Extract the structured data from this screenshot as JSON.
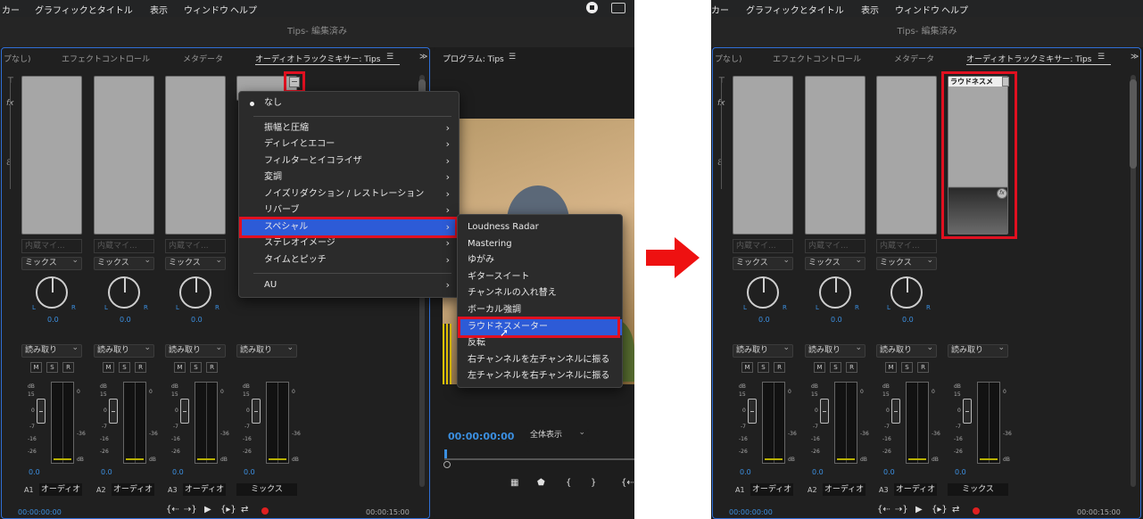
{
  "menubar": {
    "items": [
      "カー",
      "グラフィックとタイトル",
      "表示",
      "ウィンドウ",
      "ヘルプ"
    ]
  },
  "window_title": "Tips- 編集済み",
  "tabs": {
    "t1": "プなし)",
    "t2": "エフェクトコントロール",
    "t3": "メタデータ",
    "t4": "オーディオトラックミキサー: Tips",
    "more": "≫",
    "program": "プログラム: Tips"
  },
  "channels": [
    {
      "input": "内蔵マイ...",
      "mix": "ミックス",
      "pan": "0.0",
      "auto": "読み取り",
      "level": "0.0",
      "track_id": "A1",
      "track_name": "オーディオ"
    },
    {
      "input": "内蔵マイ...",
      "mix": "ミックス",
      "pan": "0.0",
      "auto": "読み取り",
      "level": "0.0",
      "track_id": "A2",
      "track_name": "オーディオ"
    },
    {
      "input": "内蔵マイ...",
      "mix": "ミックス",
      "pan": "0.0",
      "auto": "読み取り",
      "level": "0.0",
      "track_id": "A3",
      "track_name": "オーディオ"
    },
    {
      "auto": "読み取り",
      "level": "0.0",
      "track_name": "ミックス"
    }
  ],
  "knob_labels": {
    "l": "L",
    "r": "R"
  },
  "msr": [
    "M",
    "S",
    "R"
  ],
  "db_scale": {
    "db": "dB",
    "v15": "15",
    "v0": "0",
    "vm7": "-7",
    "vm16": "-16",
    "vm26": "-26",
    "vinf": "-∞",
    "r0": "0",
    "rm36": "-36",
    "rdb": "dB"
  },
  "effect_menu": {
    "none": "なし",
    "items": [
      "振幅と圧縮",
      "ディレイとエコー",
      "フィルターとイコライザ",
      "変調",
      "ノイズリダクション / レストレーション",
      "リバーブ",
      "スペシャル",
      "ステレオイメージ",
      "タイムとピッチ"
    ],
    "au": "AU"
  },
  "special_submenu": [
    "Loudness Radar",
    "Mastering",
    "ゆがみ",
    "ギタースイート",
    "チャンネルの入れ替え",
    "ボーカル強調",
    "ラウドネスメーター",
    "反転",
    "右チャンネルを左チャンネルに振る",
    "左チャンネルを右チャンネルに振る"
  ],
  "program": {
    "timecode": "00:00:00:00",
    "zoom": "全体表示"
  },
  "timecode_left": "00:00:00:00",
  "timecode_right": "00:00:15:00",
  "after_effect_label": "ラウドネスメ",
  "colors": {
    "highlight": "#e01020",
    "selection": "#2d5bd7",
    "accent": "#3b8fe0",
    "arrow": "#ee1111"
  }
}
